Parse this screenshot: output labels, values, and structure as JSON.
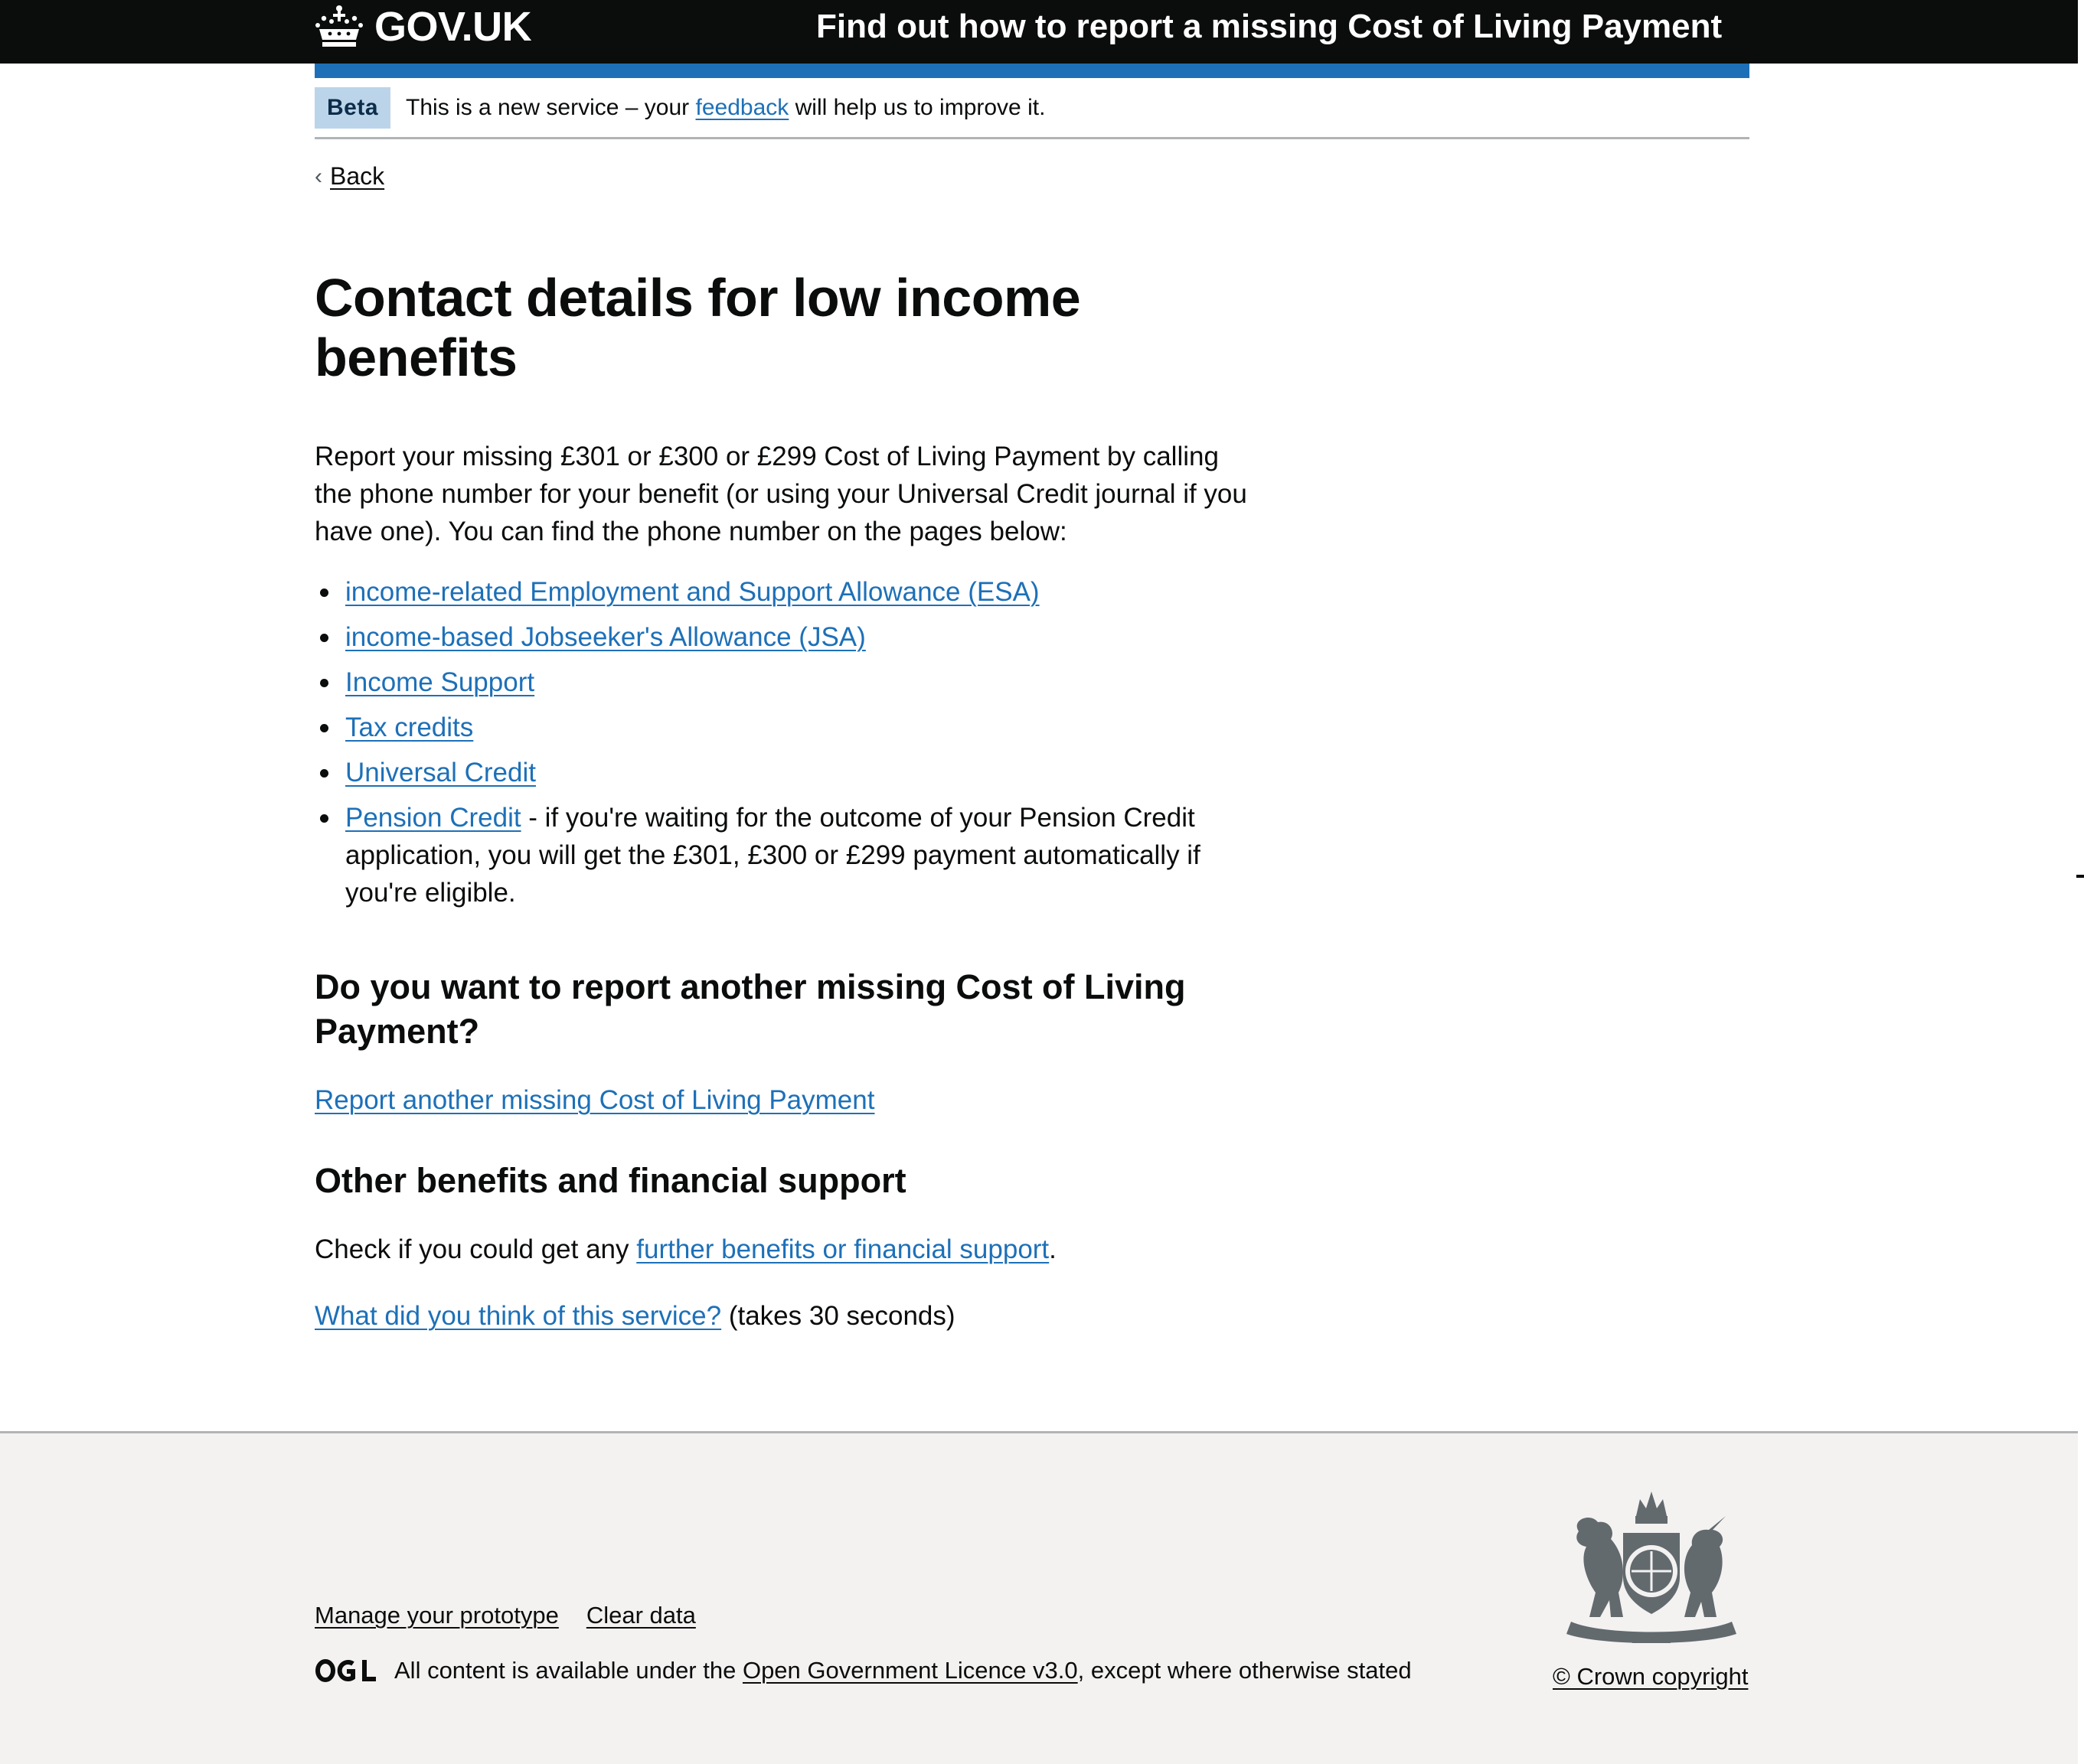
{
  "header": {
    "logo_text": "GOV.UK",
    "service_name": "Find out how to report a missing Cost of Living Payment"
  },
  "phase_banner": {
    "tag": "Beta",
    "text_before": "This is a new service – your ",
    "link": "feedback",
    "text_after": " will help us to improve it."
  },
  "back_link": "Back",
  "main": {
    "title": "Contact details for low income benefits",
    "intro": "Report your missing £301 or £300 or £299 Cost of Living Payment by calling the phone number for your benefit (or using your Universal Credit journal if you have one). You can find the phone number on the pages below:",
    "benefits": [
      "income-related Employment and Support Allowance (ESA)",
      "income-based Jobseeker's Allowance (JSA)",
      "Income Support",
      "Tax credits",
      "Universal Credit",
      "Pension Credit"
    ],
    "pension_credit_note": " - if you're waiting for the outcome of your Pension Credit application, you will get the £301, £300 or £299 payment automatically if you're eligible.",
    "another_heading": "Do you want to report another missing Cost of Living Payment?",
    "another_link": "Report another missing Cost of Living Payment",
    "other_heading": "Other benefits and financial support",
    "other_text_before": "Check if you could get any ",
    "other_link": "further benefits or financial support",
    "other_text_after": ".",
    "feedback_link": "What did you think of this service?",
    "feedback_after": " (takes 30 seconds)"
  },
  "footer": {
    "links": [
      "Manage your prototype",
      "Clear data"
    ],
    "licence_before": "All content is available under the ",
    "licence_link": "Open Government Licence v3.0",
    "licence_after": ", except where otherwise stated",
    "copyright": "© Crown copyright"
  },
  "colors": {
    "header_bg": "#0b0c0c",
    "brand_blue": "#1d70b8",
    "link": "#1d70b8",
    "footer_bg": "#f3f2f1",
    "tag_bg": "#bbd4ea"
  },
  "icons": [
    "crown-icon",
    "back-chevron-icon",
    "ogl-logo-icon",
    "royal-coat-of-arms-icon"
  ]
}
